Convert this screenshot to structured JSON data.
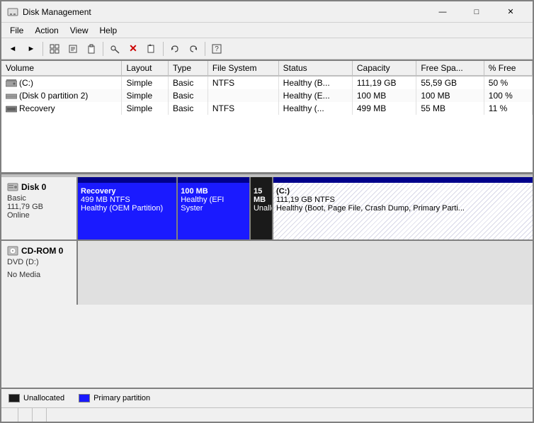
{
  "window": {
    "title": "Disk Management",
    "icon": "💾"
  },
  "titlebar": {
    "minimize": "—",
    "maximize": "□",
    "close": "✕"
  },
  "menu": {
    "items": [
      "File",
      "Action",
      "View",
      "Help"
    ]
  },
  "toolbar": {
    "buttons": [
      "←",
      "→",
      "⊞",
      "📋",
      "📋",
      "🔑",
      "✕",
      "📄",
      "↩",
      "↪",
      "⊟"
    ]
  },
  "table": {
    "columns": [
      "Volume",
      "Layout",
      "Type",
      "File System",
      "Status",
      "Capacity",
      "Free Spa...",
      "% Free"
    ],
    "rows": [
      {
        "icon": "drive",
        "volume": "(C:)",
        "layout": "Simple",
        "type": "Basic",
        "filesystem": "NTFS",
        "status": "Healthy (B...",
        "capacity": "111,19 GB",
        "free_space": "55,59 GB",
        "percent_free": "50 %"
      },
      {
        "icon": "partition",
        "volume": "(Disk 0 partition 2)",
        "layout": "Simple",
        "type": "Basic",
        "filesystem": "",
        "status": "Healthy (E...",
        "capacity": "100 MB",
        "free_space": "100 MB",
        "percent_free": "100 %"
      },
      {
        "icon": "recovery",
        "volume": "Recovery",
        "layout": "Simple",
        "type": "Basic",
        "filesystem": "NTFS",
        "status": "Healthy (...",
        "capacity": "499 MB",
        "free_space": "55 MB",
        "percent_free": "11 %"
      }
    ]
  },
  "disks": [
    {
      "name": "Disk 0",
      "type": "Basic",
      "size": "111,79 GB",
      "status": "Online",
      "partitions": [
        {
          "id": "recovery",
          "name": "Recovery",
          "size": "499 MB NTFS",
          "detail": "Healthy (OEM Partition)"
        },
        {
          "id": "efi",
          "name": "100 MB",
          "size": "",
          "detail": "Healthy (EFI Syster"
        },
        {
          "id": "unalloc",
          "name": "15 MB",
          "size": "",
          "detail": "Unalloca..."
        },
        {
          "id": "c",
          "name": "(C:)",
          "size": "111,19 GB NTFS",
          "detail": "Healthy (Boot, Page File, Crash Dump, Primary Parti..."
        }
      ]
    },
    {
      "name": "CD-ROM 0",
      "type": "DVD (D:)",
      "size": "",
      "status": "No Media",
      "partitions": []
    }
  ],
  "legend": {
    "items": [
      {
        "label": "Unallocated",
        "type": "unalloc"
      },
      {
        "label": "Primary partition",
        "type": "primary"
      }
    ]
  },
  "statusbar": {
    "segments": [
      "",
      "",
      ""
    ]
  }
}
